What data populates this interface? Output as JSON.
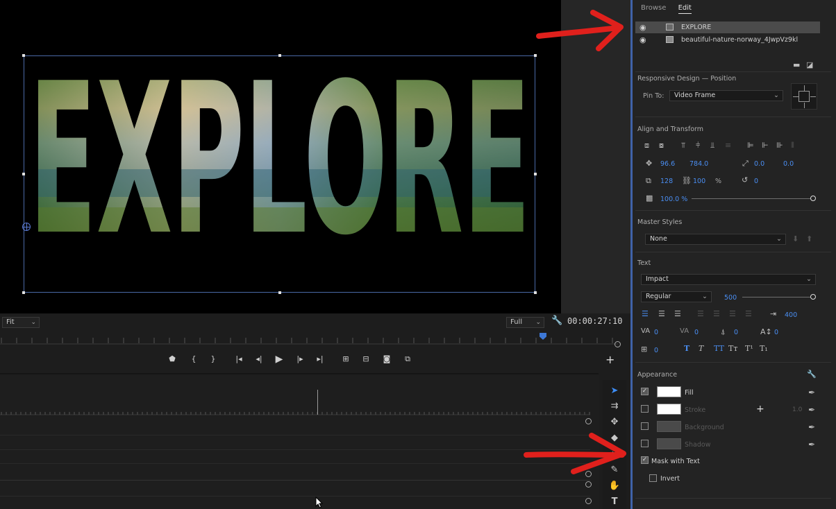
{
  "monitor": {
    "title_text": "EXPLORE",
    "fit_label": "Fit",
    "quality_label": "Full",
    "timecode": "00:00:27:10"
  },
  "panel": {
    "tabs": [
      {
        "label": "Browse"
      },
      {
        "label": "Edit"
      }
    ],
    "layers": [
      {
        "name": "EXPLORE"
      },
      {
        "name": "beautiful-nature-norway_4JwpVz9kl"
      }
    ],
    "responsive": {
      "title": "Responsive Design — Position",
      "pin_label": "Pin To:",
      "pin_value": "Video Frame"
    },
    "align": {
      "title": "Align and Transform",
      "pos_x": "96.6",
      "pos_y": "784.0",
      "anchor_x": "0.0",
      "anchor_y": "0.0",
      "scale": "128",
      "scale_h": "100",
      "percent": "%",
      "rotation": "0",
      "opacity": "100.0 %"
    },
    "master": {
      "title": "Master Styles",
      "value": "None"
    },
    "text": {
      "title": "Text",
      "font": "Impact",
      "style": "Regular",
      "size": "500",
      "tab_width": "400",
      "kerning": "0",
      "tracking": "0",
      "leading": "0",
      "baseline": "0",
      "tsume": "0",
      "style_buttons": [
        "T",
        "T",
        "TT",
        "Tт",
        "T¹",
        "T₁"
      ]
    },
    "appearance": {
      "title": "Appearance",
      "fill": "Fill",
      "stroke": "Stroke",
      "stroke_width": "1.0",
      "background": "Background",
      "shadow": "Shadow",
      "mask": "Mask with Text",
      "invert": "Invert"
    }
  },
  "colors": {
    "accent": "#4a8ef2",
    "selection": "#3f62a8",
    "annotation": "#e0201c"
  }
}
